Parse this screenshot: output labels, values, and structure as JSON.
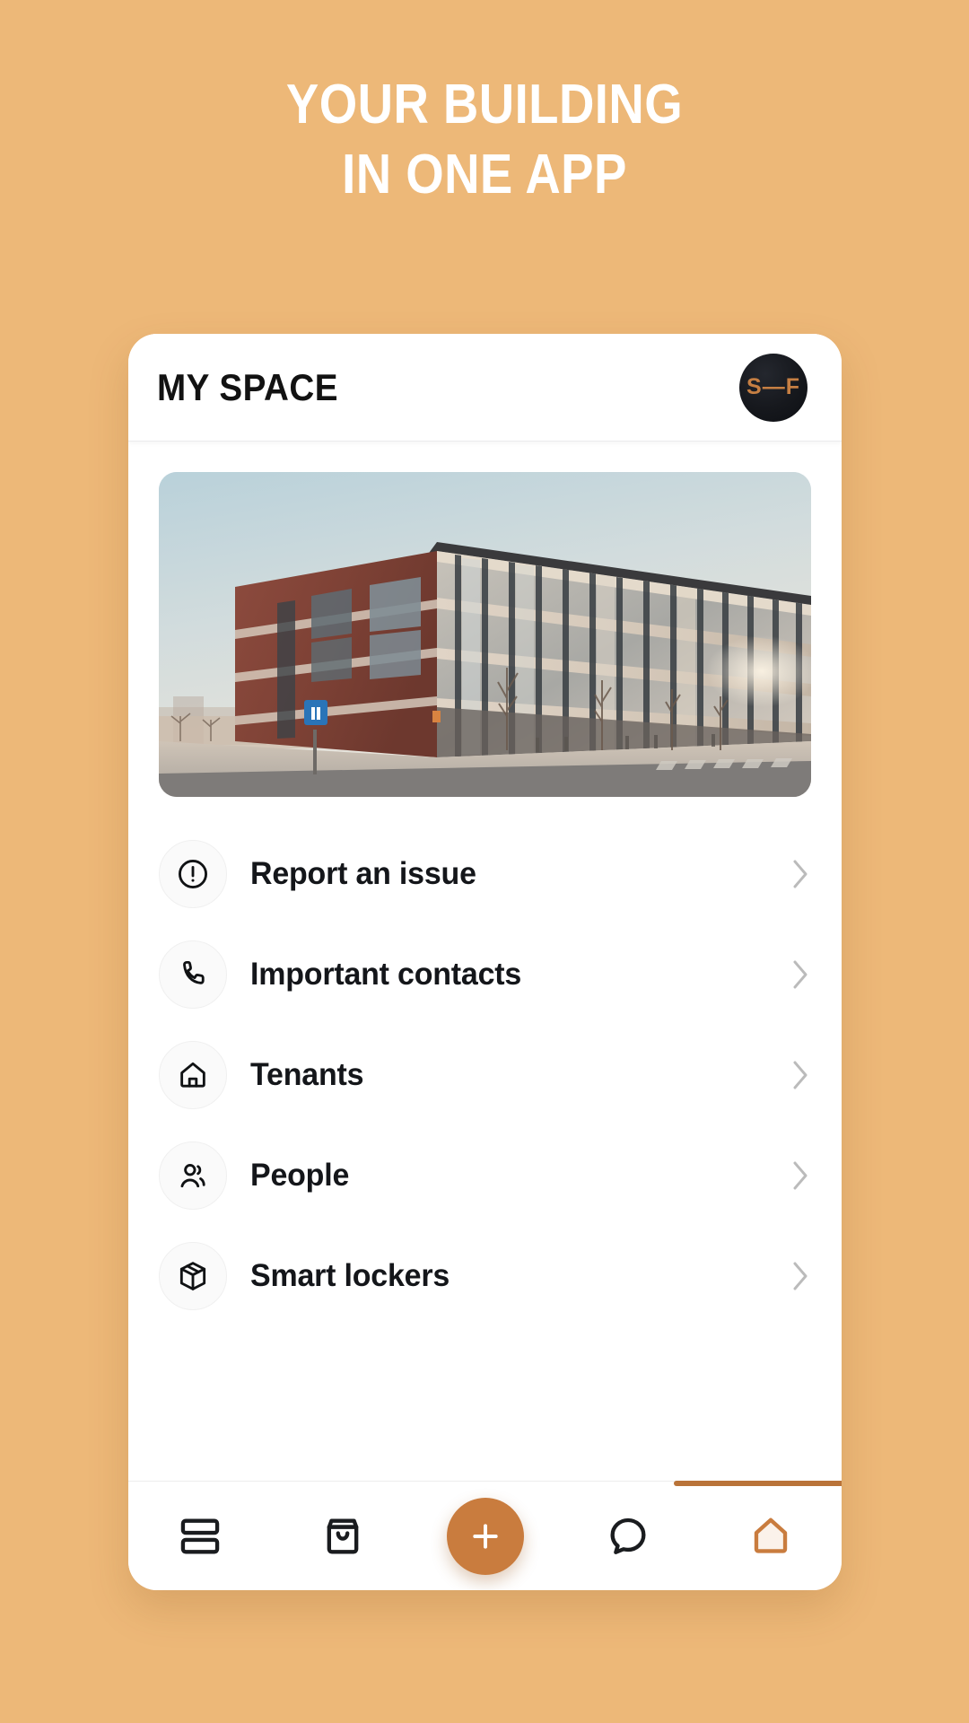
{
  "headline": {
    "line1": "YOUR BUILDING",
    "line2": "IN ONE APP"
  },
  "colors": {
    "background": "#edb878",
    "accent": "#c97c3e",
    "active_indicator": "#b97338",
    "avatar_bg": "#16181d",
    "avatar_text": "#c67f43",
    "card_bg": "#ffffff",
    "text_primary": "#14161a"
  },
  "app": {
    "header": {
      "title": "MY SPACE",
      "avatar_initials": "S—F",
      "avatar_icon": "user-avatar"
    },
    "hero": {
      "icon": "building-photo",
      "alt": "Modern brick and glass office building at sunset"
    },
    "menu": {
      "items": [
        {
          "label": "Report an issue",
          "icon": "alert-circle-icon",
          "chevron": "chevron-right-icon"
        },
        {
          "label": "Important contacts",
          "icon": "phone-icon",
          "chevron": "chevron-right-icon"
        },
        {
          "label": "Tenants",
          "icon": "house-icon",
          "chevron": "chevron-right-icon"
        },
        {
          "label": "People",
          "icon": "people-icon",
          "chevron": "chevron-right-icon"
        },
        {
          "label": "Smart lockers",
          "icon": "package-box-icon",
          "chevron": "chevron-right-icon"
        }
      ]
    },
    "bottom_nav": {
      "items": [
        {
          "icon": "dashboard-icon",
          "active": false
        },
        {
          "icon": "shopping-bag-icon",
          "active": false
        },
        {
          "icon": "plus-icon",
          "active": false,
          "is_fab": true
        },
        {
          "icon": "chat-bubble-icon",
          "active": false
        },
        {
          "icon": "home-icon",
          "active": true
        }
      ]
    }
  }
}
